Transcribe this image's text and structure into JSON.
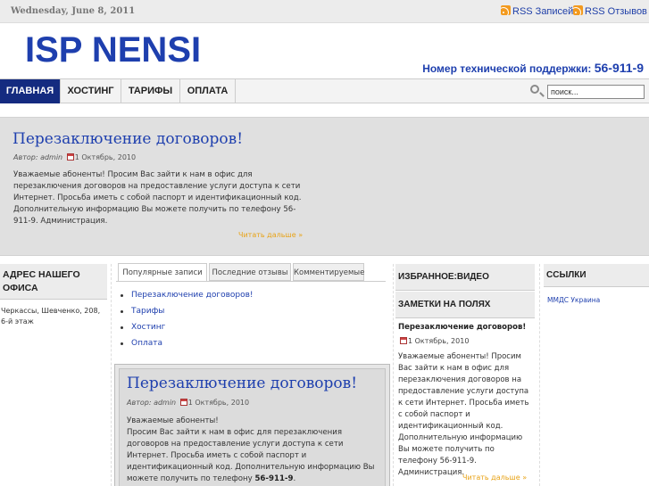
{
  "topbar": {
    "date": "Wednesday, June 8, 2011",
    "rss_posts": "RSS Записей",
    "rss_comments": "RSS Отзывов"
  },
  "header": {
    "logo": "ISP NENSI",
    "support_label": "Номер технической поддержки:",
    "support_number": "56-911-9"
  },
  "nav": {
    "items": [
      "ГЛАВНАЯ",
      "ХОСТИНГ",
      "ТАРИФЫ",
      "ОПЛАТА"
    ],
    "active": "ГЛАВНАЯ",
    "search_placeholder": "поиск..."
  },
  "featured": {
    "title": "Перезаключение договоров!",
    "author_label": "Автор:",
    "author": "admin",
    "date": "1 Октябрь, 2010",
    "body": "Уважаемые абоненты! Просим Вас зайти к нам в офис для перезаключения договоров на предоставление услуги доступа к сети Интернет. Просьба иметь с собой паспорт и идентификационный код. Дополнительную информацию Вы можете получить по телефону 56-911-9. Администрация.",
    "more": "Читать дальше »"
  },
  "col1": {
    "heading": "АДРЕС НАШЕГО ОФИСА",
    "address": "Черкассы, Шевченко, 208, 6-й этаж"
  },
  "tabs": {
    "labels": [
      "Популярные записи",
      "Последние отзывы",
      "Комментируемые"
    ],
    "items": [
      "Перезаключение договоров!",
      "Тарифы",
      "Хостинг",
      "Оплата"
    ]
  },
  "post": {
    "title": "Перезаключение договоров!",
    "author_label": "Автор:",
    "author": "admin",
    "date": "1 Октябрь, 2010",
    "greeting": "Уважаемые абоненты!",
    "body": "Просим Вас зайти к нам в офис для перезаключения договоров на предоставление услуги доступа к сети Интернет. Просьба иметь с собой паспорт и идентификационный код. Дополнительную информацию Вы можете получить по телефону",
    "phone": "56-911-9",
    "phone_suffix": "."
  },
  "col3": {
    "video_heading": "ИЗБРАННОЕ:ВИДЕО",
    "notes_heading": "ЗАМЕТКИ НА ПОЛЯХ",
    "post_title": "Перезаключение договоров!",
    "date": "1 Октябрь, 2010",
    "body": "Уважаемые абоненты! Просим Вас зайти к нам в офис для перезаключения договоров на предоставление услуги доступа к сети Интернет. Просьба иметь с собой паспорт и идентификационный код. Дополнительную информацию Вы можете получить по телефону 56-911-9. Администрация.",
    "more": "Читать дальше »"
  },
  "col4": {
    "heading": "ССЫЛКИ",
    "link": "ММДС Украина"
  },
  "colors": {
    "brand_blue": "#1e3fae",
    "nav_active": "#142b80",
    "more_link": "#e8a317"
  }
}
